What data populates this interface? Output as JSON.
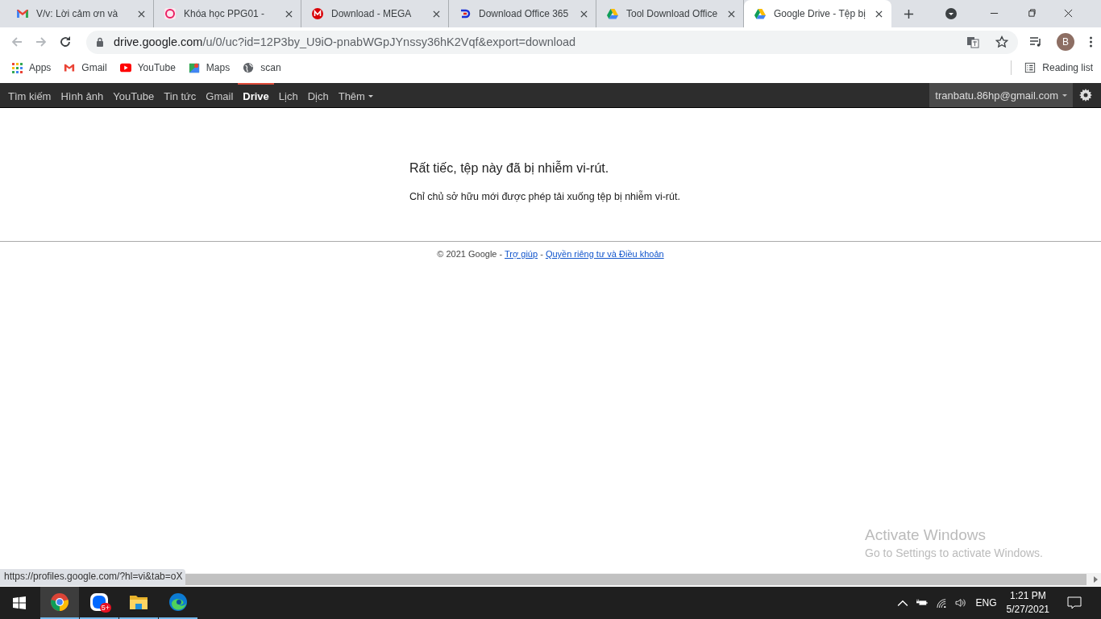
{
  "tabs": [
    {
      "title": "V/v: Lời cảm ơn và",
      "selected": false
    },
    {
      "title": "Khóa học PPG01 -",
      "selected": false
    },
    {
      "title": "Download - MEGA",
      "selected": false
    },
    {
      "title": "Download Office 365",
      "selected": false
    },
    {
      "title": "Tool Download Office",
      "selected": false
    },
    {
      "title": "Google Drive - Tệp bị",
      "selected": true
    }
  ],
  "address_bar": {
    "url_host": "drive.google.com",
    "url_path": "/u/0/uc?id=12P3by_U9iO-pnabWGpJYnssy36hK2Vqf&export=download"
  },
  "profile": {
    "initial": "B"
  },
  "bookmarks": [
    "Apps",
    "Gmail",
    "YouTube",
    "Maps",
    "scan"
  ],
  "reading_list": "Reading list",
  "google_bar": {
    "items": [
      {
        "label": "Tìm kiếm",
        "selected": false
      },
      {
        "label": "Hình ảnh",
        "selected": false
      },
      {
        "label": "YouTube",
        "selected": false
      },
      {
        "label": "Tin tức",
        "selected": false
      },
      {
        "label": "Gmail",
        "selected": false
      },
      {
        "label": "Drive",
        "selected": true
      },
      {
        "label": "Lịch",
        "selected": false
      },
      {
        "label": "Dịch",
        "selected": false
      },
      {
        "label": "Thêm",
        "selected": false
      }
    ],
    "account": "tranbatu.86hp@gmail.com"
  },
  "message": {
    "heading": "Rất tiếc, tệp này đã bị nhiễm vi-rút.",
    "body": "Chỉ chủ sở hữu mới được phép tải xuống tệp bị nhiễm vi-rút."
  },
  "footer": [
    {
      "kind": "text",
      "text": "© 2021 Google - "
    },
    {
      "kind": "link",
      "text": "Trợ giúp"
    },
    {
      "kind": "text",
      "text": " - "
    },
    {
      "kind": "link",
      "text": "Quyền riêng tư và Điều khoản"
    }
  ],
  "status_url": "https://profiles.google.com/?hl=vi&tab=oX",
  "activation": {
    "title": "Activate Windows",
    "subtitle": "Go to Settings to activate Windows."
  },
  "taskbar": {
    "badge": "5+",
    "language": "ENG",
    "time": "1:21 PM",
    "date": "5/27/2021"
  }
}
